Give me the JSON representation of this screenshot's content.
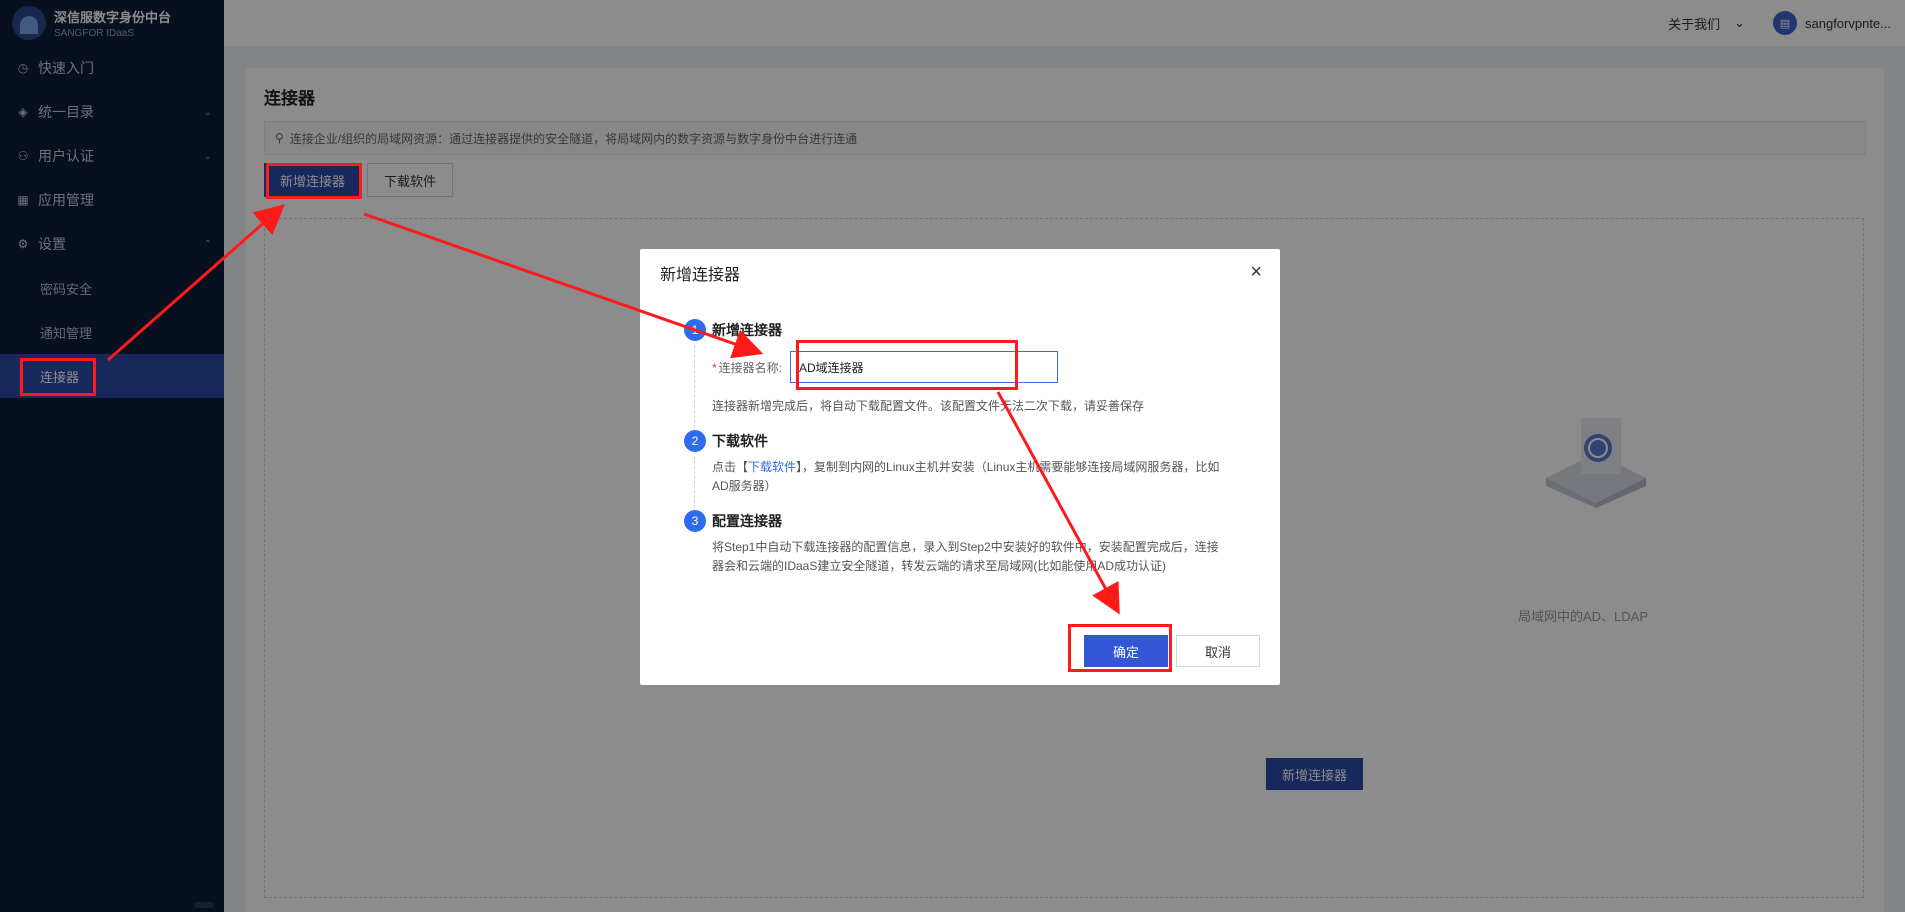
{
  "sidebar": {
    "brand_title": "深信服数字身份中台",
    "brand_subtitle": "SANGFOR IDaaS",
    "items": [
      {
        "label": "快速入门",
        "icon": "clock-icon"
      },
      {
        "label": "统一目录",
        "icon": "layers-icon"
      },
      {
        "label": "用户认证",
        "icon": "user-icon"
      },
      {
        "label": "应用管理",
        "icon": "grid-icon"
      },
      {
        "label": "设置",
        "icon": "gear-icon"
      }
    ],
    "sub_items": [
      {
        "label": "密码安全"
      },
      {
        "label": "通知管理"
      },
      {
        "label": "连接器"
      }
    ]
  },
  "header": {
    "about_label": "关于我们",
    "user_name": "sangforvpnte..."
  },
  "page": {
    "title": "连接器",
    "tip": "连接企业/组织的局域网资源：通过连接器提供的安全隧道，将局域网内的数字资源与数字身份中台进行连通",
    "add_button": "新增连接器",
    "download_button": "下载软件",
    "empty_text": "局域网中的AD、LDAP",
    "empty_add_button": "新增连接器"
  },
  "modal": {
    "title": "新增连接器",
    "close": "×",
    "step1": {
      "num": "1",
      "title": "新增连接器",
      "field_label": "连接器名称:",
      "field_value": "AD域连接器",
      "desc": "连接器新增完成后，将自动下载配置文件。该配置文件无法二次下载，请妥善保存"
    },
    "step2": {
      "num": "2",
      "title": "下载软件",
      "desc_prefix": "点击【",
      "desc_link": "下载软件",
      "desc_suffix": "】，复制到内网的Linux主机并安装（Linux主机需要能够连接局域网服务器，比如AD服务器）"
    },
    "step3": {
      "num": "3",
      "title": "配置连接器",
      "desc": "将Step1中自动下载连接器的配置信息，录入到Step2中安装好的软件中，安装配置完成后，连接器会和云端的IDaaS建立安全隧道，转发云端的请求至局域网(比如能使用AD成功认证)"
    },
    "ok_button": "确定",
    "cancel_button": "取消"
  },
  "colors": {
    "sidebar_bg": "#0f1d3a",
    "primary": "#2a4aa8",
    "annotation": "#ff1a1a"
  }
}
